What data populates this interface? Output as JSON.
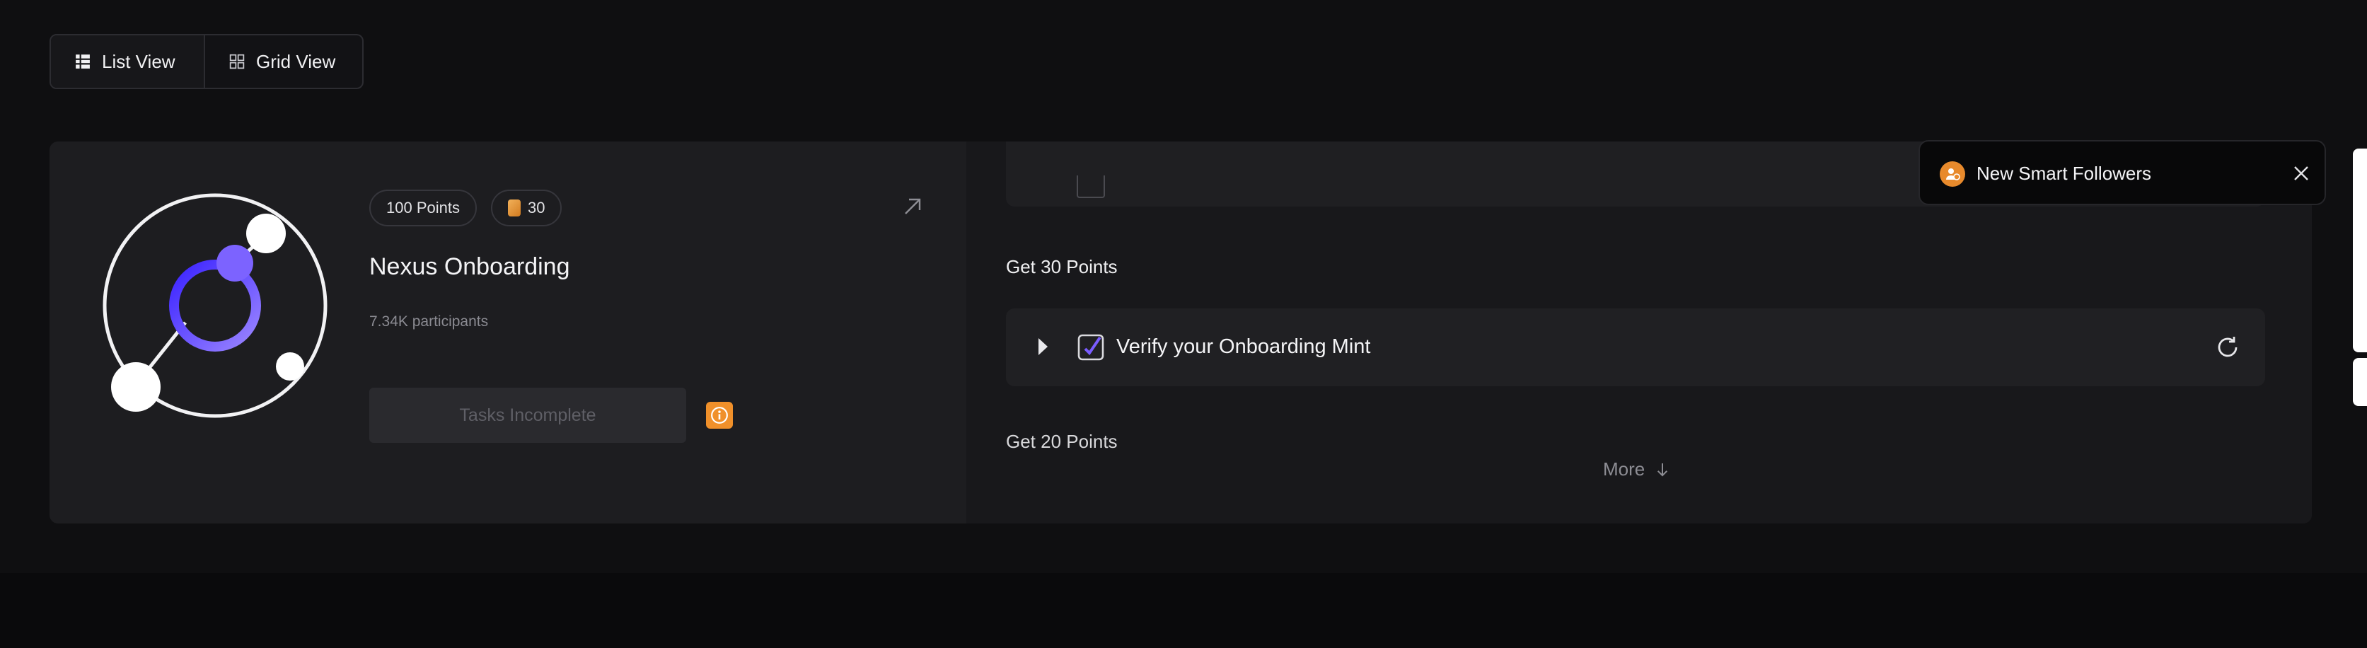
{
  "view_toggle": {
    "list_label": "List View",
    "grid_label": "Grid View"
  },
  "quest": {
    "points_badge": "100 Points",
    "coin_badge": "30",
    "title": "Nexus Onboarding",
    "participants": "7.34K participants",
    "action_label": "Tasks Incomplete"
  },
  "tasks": {
    "section_30": "Get 30 Points",
    "task_1_label": "Verify your Onboarding Mint",
    "section_20": "Get 20 Points",
    "more_label": "More"
  },
  "toast": {
    "message": "New Smart Followers"
  },
  "colors": {
    "accent_purple": "#6b4cff",
    "accent_orange": "#f0902a",
    "background": "#0f0f11"
  }
}
